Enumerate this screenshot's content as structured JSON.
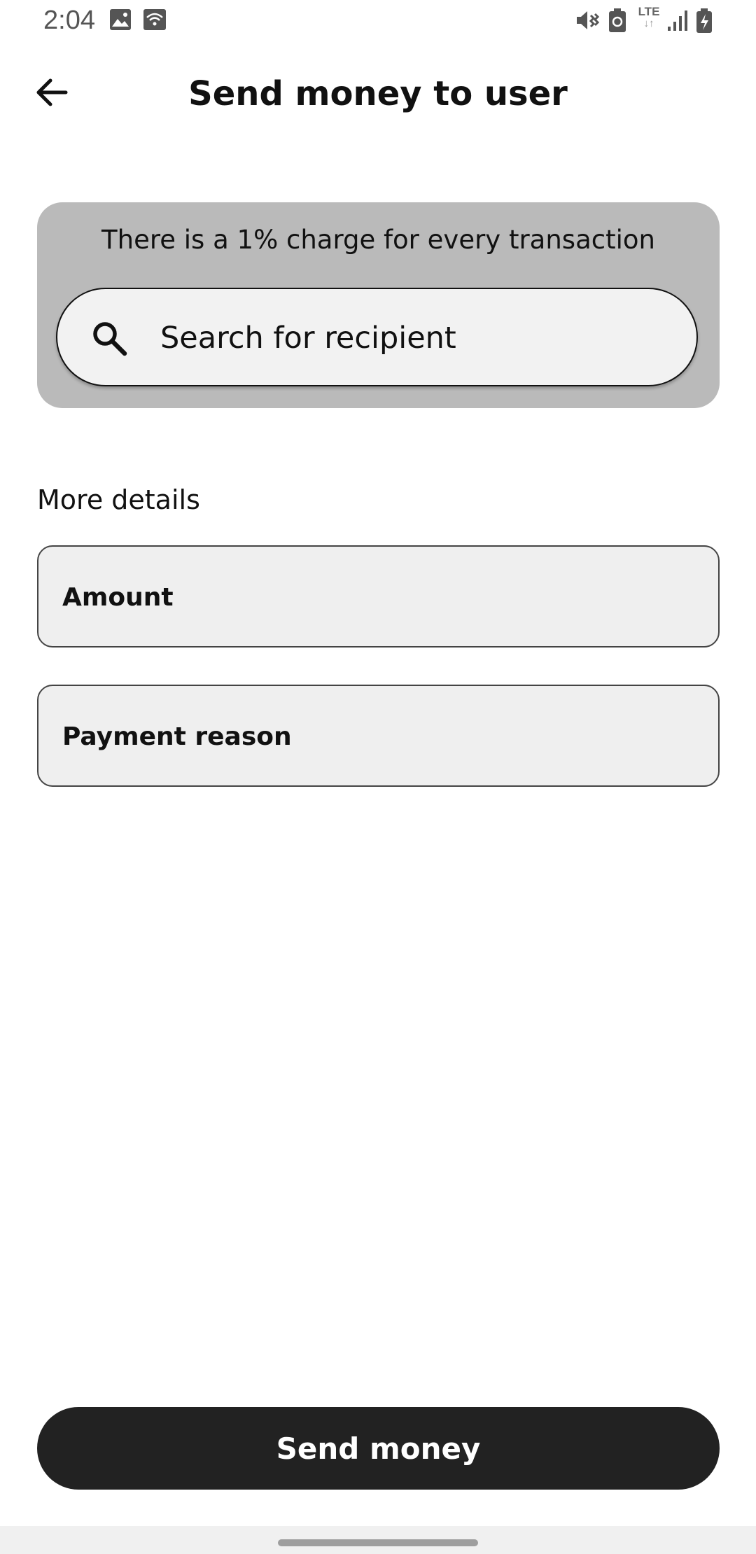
{
  "status_bar": {
    "time": "2:04",
    "network_label": "LTE",
    "network_arrows": "↓↑",
    "icons": [
      "image-icon",
      "wifi-icon",
      "vibrate-icon",
      "battery-saver-icon",
      "signal-icon",
      "battery-charging-icon"
    ]
  },
  "header": {
    "title": "Send money to user",
    "back_icon": "arrow-left-icon"
  },
  "notice": {
    "text": "There is a 1% charge for every transaction"
  },
  "search": {
    "placeholder": "Search for recipient",
    "value": "",
    "icon": "search-icon"
  },
  "details": {
    "label": "More details",
    "amount_placeholder": "Amount",
    "reason_placeholder": "Payment reason"
  },
  "actions": {
    "send_label": "Send money"
  },
  "colors": {
    "card_bg": "#bababa",
    "button_bg": "#222222",
    "field_bg": "#efefef"
  }
}
